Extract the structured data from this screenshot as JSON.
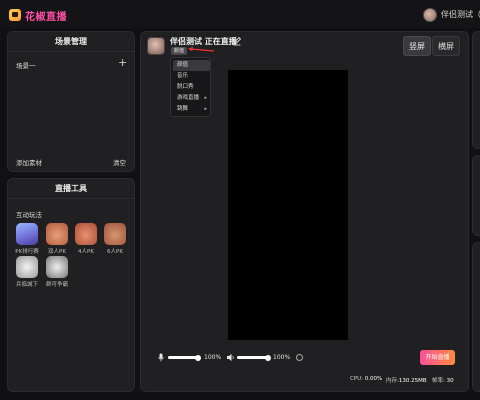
{
  "header": {
    "app_name": "花椒直播",
    "user_name": "伴侣测试（666"
  },
  "scene_panel": {
    "title": "场景管理",
    "scene_item": "场景一",
    "add_material": "添加素材",
    "clear": "清空"
  },
  "tools_panel": {
    "title": "直播工具",
    "section_label": "互动玩法",
    "tools": [
      {
        "label": "PK排行赛"
      },
      {
        "label": "双人PK"
      },
      {
        "label": "4人PK"
      },
      {
        "label": "6人PK"
      },
      {
        "label": "兵临城下"
      },
      {
        "label": "群可争霸"
      }
    ]
  },
  "stream": {
    "title": "伴侣测试 正在直播",
    "category": "颜值",
    "orientation_portrait": "竖屏",
    "orientation_landscape": "横屏"
  },
  "category_menu": {
    "items": [
      {
        "label": "颜值",
        "has_submenu": false
      },
      {
        "label": "音乐",
        "has_submenu": false
      },
      {
        "label": "脱口秀",
        "has_submenu": false
      },
      {
        "label": "游戏直播",
        "has_submenu": true
      },
      {
        "label": "跳舞",
        "has_submenu": true
      }
    ]
  },
  "controls": {
    "mic_volume": "100%",
    "mic_level": 1.0,
    "speaker_volume": "100%",
    "speaker_level": 1.0,
    "go_live": "开始直播"
  },
  "status_bar": {
    "cpu_label": "CPU:",
    "cpu_value": "0.00%",
    "memory_label": "内存:",
    "memory_value": "130.25MB",
    "fps_label": "帧率:",
    "fps_value": "30"
  },
  "colors": {
    "brand_pink": "#ff4fa8",
    "go_live_gradient_start": "#ff4f9a",
    "go_live_gradient_end": "#ff8a3d",
    "arrow_red": "#e33"
  }
}
